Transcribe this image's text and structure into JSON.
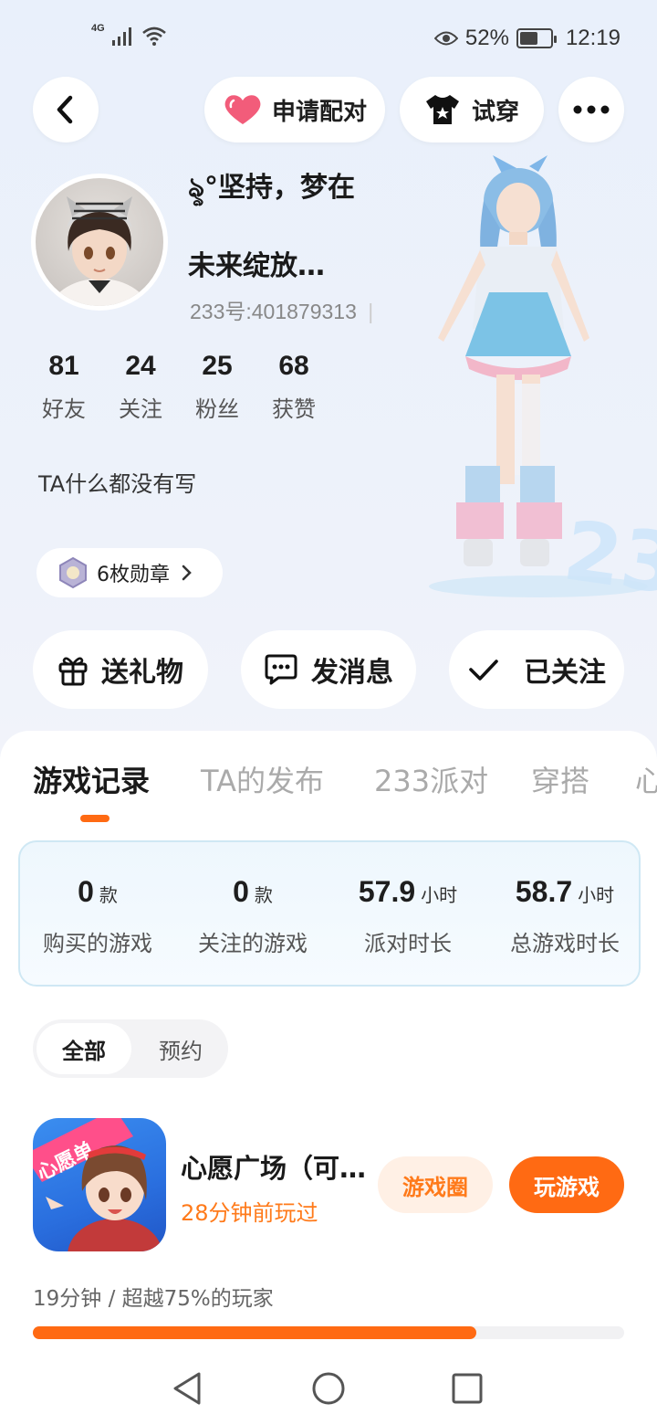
{
  "status_bar": {
    "network": "4G",
    "battery_percent": "52%",
    "time": "12:19"
  },
  "header": {
    "pair_label": "申请配对",
    "try_on_label": "试穿"
  },
  "profile": {
    "username_line1": "ৡ°坚持，梦在",
    "username_line2": "未来绽放…",
    "uid": "233号:401879313",
    "stats": [
      {
        "value": "81",
        "label": "好友"
      },
      {
        "value": "24",
        "label": "关注"
      },
      {
        "value": "25",
        "label": "粉丝"
      },
      {
        "value": "68",
        "label": "获赞"
      }
    ],
    "bio": "TA什么都没有写",
    "badge_label": "6枚勋章"
  },
  "actions": {
    "gift": "送礼物",
    "message": "发消息",
    "follow": "已关注"
  },
  "tabs": [
    {
      "label": "游戏记录",
      "active": true
    },
    {
      "label": "TA的发布",
      "active": false
    },
    {
      "label": "233派对",
      "active": false
    },
    {
      "label": "穿搭",
      "active": false
    },
    {
      "label": "心",
      "active": false
    }
  ],
  "summary": [
    {
      "value": "0",
      "unit": "款",
      "label": "购买的游戏"
    },
    {
      "value": "0",
      "unit": "款",
      "label": "关注的游戏"
    },
    {
      "value": "57.9",
      "unit": "小时",
      "label": "派对时长"
    },
    {
      "value": "58.7",
      "unit": "小时",
      "label": "总游戏时长"
    }
  ],
  "filters": {
    "all": "全部",
    "reserve": "预约"
  },
  "game": {
    "icon_ribbon": "心愿单",
    "name": "心愿广场（可…",
    "last_played": "28分钟前玩过",
    "circle_button": "游戏圈",
    "play_button": "玩游戏",
    "play_stat": "19分钟 / 超越75%的玩家",
    "progress_percent": 75
  },
  "colors": {
    "accent": "#ff6a13",
    "accent_text": "#ff7a1a",
    "heart": "#f25c7a"
  }
}
